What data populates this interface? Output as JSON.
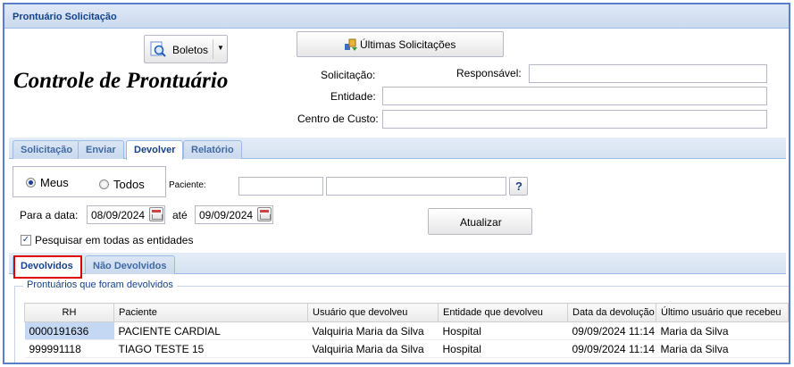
{
  "window": {
    "title": "Prontuário Solicitação"
  },
  "toolbar": {
    "boletos_label": "Boletos",
    "ultimas_label": "Últimas Solicitações"
  },
  "header": {
    "page_title": "Controle de Prontuário"
  },
  "form": {
    "solicitacao_label": "Solicitação:",
    "responsavel_label": "Responsável:",
    "entidade_label": "Entidade:",
    "centro_custo_label": "Centro de Custo:"
  },
  "main_tabs": [
    {
      "label": "Solicitação",
      "active": false
    },
    {
      "label": "Enviar",
      "active": false
    },
    {
      "label": "Devolver",
      "active": true
    },
    {
      "label": "Relatório",
      "active": false
    }
  ],
  "filters": {
    "meus_label": "Meus",
    "todos_label": "Todos",
    "selected": "Meus",
    "paciente_label": "Paciente:",
    "help_label": "?",
    "para_data_label": "Para a data:",
    "data_inicio": "08/09/2024",
    "ate_label": "até",
    "data_fim": "09/09/2024",
    "atualizar_label": "Atualizar",
    "pesquisar_todas_label": "Pesquisar em todas as entidades",
    "pesquisar_todas_checked": true
  },
  "sub_tabs": [
    {
      "label": "Devolvidos",
      "active": true
    },
    {
      "label": "Não Devolvidos",
      "active": false
    }
  ],
  "section": {
    "legend": "Prontuários que foram devolvidos"
  },
  "table": {
    "columns": [
      "RH",
      "Paciente",
      "Usuário que devolveu",
      "Entidade que devolveu",
      "Data da devolução",
      "Último usuário que recebeu"
    ],
    "rows": [
      [
        "0000191636",
        "PACIENTE CARDIAL",
        "Valquiria Maria da Silva",
        "Hospital",
        "09/09/2024 11:14",
        "Maria da Silva"
      ],
      [
        "999991118",
        "TIAGO TESTE 15",
        "Valquiria Maria da Silva",
        "Hospital",
        "09/09/2024 11:14",
        "Maria da Silva"
      ]
    ]
  },
  "colors": {
    "accent": "#15428b",
    "highlight_border": "#e00000",
    "selected_cell": "#c4d8f4"
  }
}
